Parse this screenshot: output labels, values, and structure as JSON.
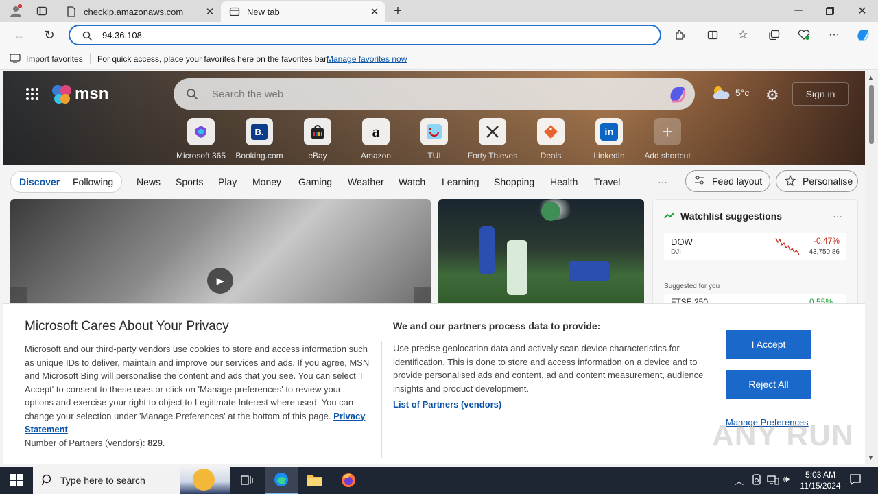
{
  "browser": {
    "tabs": [
      {
        "title": "checkip.amazonaws.com",
        "active": false
      },
      {
        "title": "New tab",
        "active": true
      }
    ],
    "address": "94.36.108.",
    "favorites_bar": {
      "import_label": "Import favorites",
      "hint": "For quick access, place your favorites here on the favorites bar.",
      "manage_link": "Manage favorites now"
    }
  },
  "msn": {
    "logo": "msn",
    "search_placeholder": "Search the web",
    "weather": "5°c",
    "sign_in": "Sign in",
    "shortcuts": [
      {
        "label": "Microsoft 365"
      },
      {
        "label": "Booking.com"
      },
      {
        "label": "eBay"
      },
      {
        "label": "Amazon"
      },
      {
        "label": "TUI"
      },
      {
        "label": "Forty Thieves"
      },
      {
        "label": "Deals"
      },
      {
        "label": "LinkedIn"
      },
      {
        "label": "Add shortcut"
      }
    ],
    "nav": {
      "discover": "Discover",
      "following": "Following",
      "items": [
        "News",
        "Sports",
        "Play",
        "Money",
        "Gaming",
        "Weather",
        "Watch",
        "Learning",
        "Shopping",
        "Health",
        "Travel"
      ],
      "more": "···",
      "feed_layout": "Feed layout",
      "personalise": "Personalise"
    },
    "watchlist": {
      "title": "Watchlist suggestions",
      "more": "···",
      "items": [
        {
          "symbol": "DOW",
          "sub": "DJI",
          "change": "-0.47%",
          "value": "43,750.86"
        }
      ],
      "suggested_label": "Suggested for you",
      "partial": {
        "symbol": "FTSE 250",
        "change": "0.55%"
      }
    }
  },
  "privacy": {
    "title": "Microsoft Cares About Your Privacy",
    "body": "Microsoft and our third-party vendors use cookies to store and access information such as unique IDs to deliver, maintain and improve our services and ads. If you agree, MSN and Microsoft Bing will personalise the content and ads that you see. You can select 'I Accept' to consent to these uses or click on 'Manage preferences' to review your options and exercise your right to object to Legitimate Interest where used.  You can change your selection under 'Manage Preferences' at the bottom of this page.",
    "privacy_link": "Privacy Statement",
    "partners_count_label": "Number of Partners (vendors):",
    "partners_count": "829",
    "purpose_title": "We and our partners process data to provide:",
    "purpose_body": "Use precise geolocation data and actively scan device characteristics for identification. This is done to store and access information on a device and to provide personalised ads and content, ad and content measurement, audience insights and product development.",
    "partners_link": "List of Partners (vendors)",
    "accept": "I Accept",
    "reject": "Reject All",
    "manage": "Manage Preferences"
  },
  "watermark": "ANY RUN",
  "taskbar": {
    "search_placeholder": "Type here to search",
    "time": "5:03 AM",
    "date": "11/15/2024"
  }
}
